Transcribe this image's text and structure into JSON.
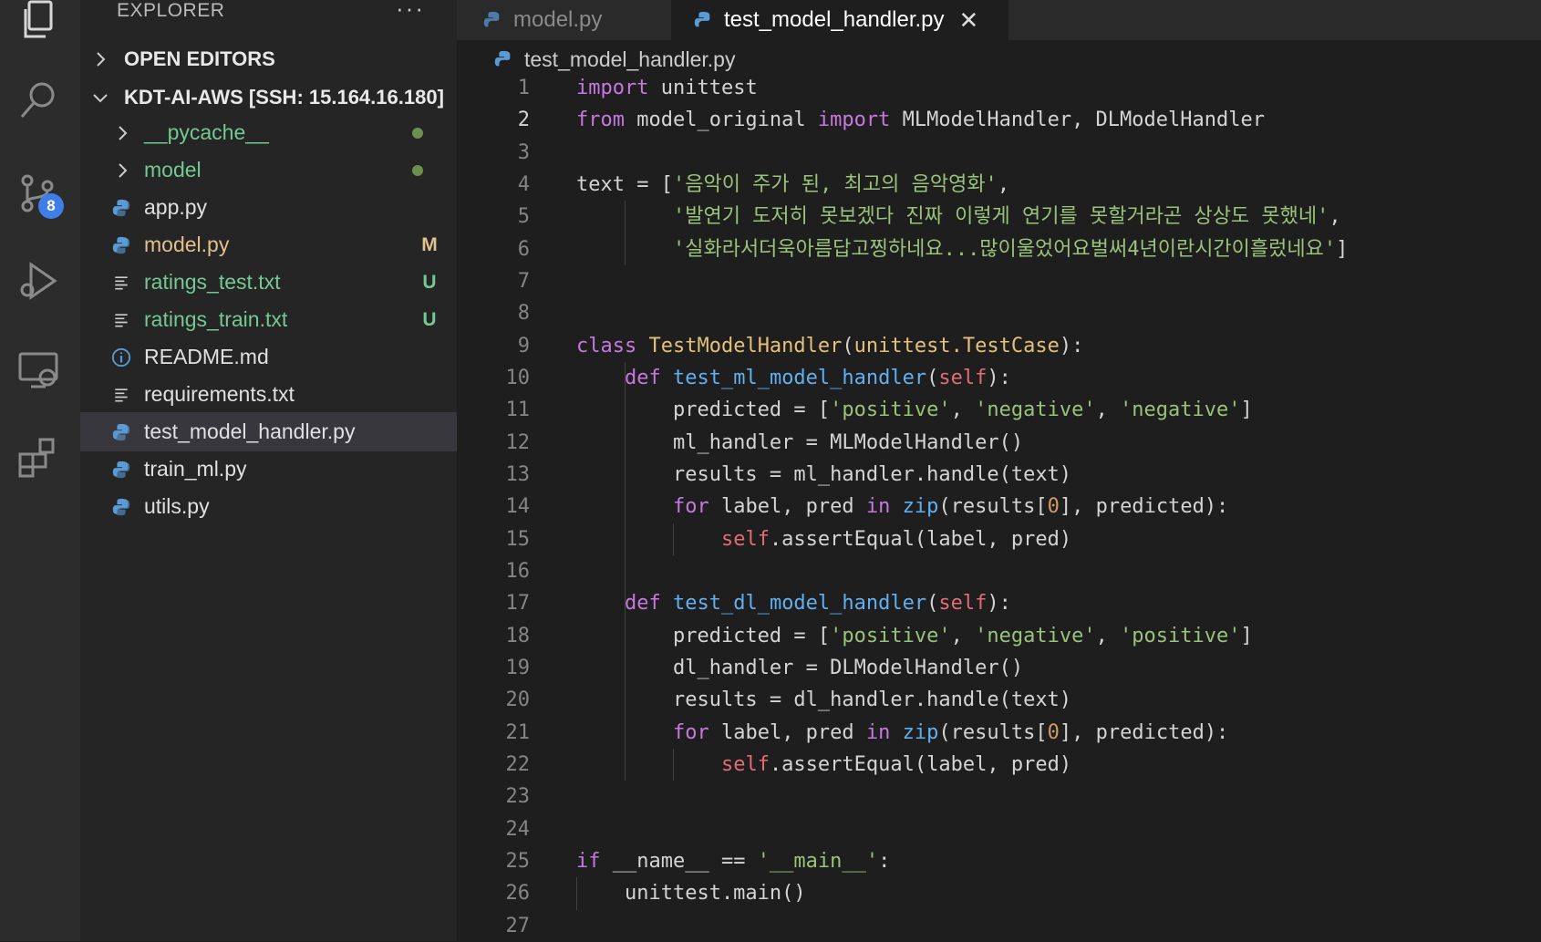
{
  "activity_bar": {
    "icons": [
      "files-icon",
      "search-icon",
      "source-control-icon",
      "run-debug-icon",
      "remote-explorer-icon",
      "extensions-icon"
    ],
    "source_control_badge": "8"
  },
  "sidebar": {
    "title": "EXPLORER",
    "more": "···",
    "open_editors": "OPEN EDITORS",
    "workspace": "KDT-AI-AWS [SSH: 15.164.16.180]",
    "items": [
      {
        "name": "__pycache__",
        "status": ""
      },
      {
        "name": "model",
        "status": ""
      },
      {
        "name": "app.py",
        "status": ""
      },
      {
        "name": "model.py",
        "status": "M"
      },
      {
        "name": "ratings_test.txt",
        "status": "U"
      },
      {
        "name": "ratings_train.txt",
        "status": "U"
      },
      {
        "name": "README.md",
        "status": ""
      },
      {
        "name": "requirements.txt",
        "status": ""
      },
      {
        "name": "test_model_handler.py",
        "status": ""
      },
      {
        "name": "train_ml.py",
        "status": ""
      },
      {
        "name": "utils.py",
        "status": ""
      }
    ]
  },
  "tabs": [
    {
      "label": "model.py"
    },
    {
      "label": "test_model_handler.py",
      "close": "✕"
    }
  ],
  "breadcrumb": "test_model_handler.py",
  "colors": {
    "keyword": "#c678dd",
    "class": "#e5c07b",
    "function": "#61afef",
    "string": "#98c379",
    "self": "#e06c75",
    "number": "#d19a66",
    "modified": "#e2c08d",
    "untracked": "#73c991"
  },
  "editor": {
    "current_line": "2",
    "line_numbers": [
      "1",
      "2",
      "3",
      "4",
      "5",
      "6",
      "7",
      "8",
      "9",
      "10",
      "11",
      "12",
      "13",
      "14",
      "15",
      "16",
      "17",
      "18",
      "19",
      "20",
      "21",
      "22",
      "23",
      "24",
      "25",
      "26",
      "27"
    ],
    "lines": [
      [
        [
          "kw",
          "import"
        ],
        [
          "t",
          " unittest"
        ]
      ],
      [
        [
          "kw",
          "from"
        ],
        [
          "t",
          " model_original "
        ],
        [
          "kw",
          "import"
        ],
        [
          "t",
          " MLModelHandler, DLModelHandler"
        ]
      ],
      [],
      [
        [
          "t",
          "text = ["
        ],
        [
          "str",
          "'음악이 주가 된, 최고의 음악영화'"
        ],
        [
          "t",
          ","
        ]
      ],
      [
        [
          "t",
          "        "
        ],
        [
          "str",
          "'발연기 도저히 못보겠다 진짜 이렇게 연기를 못할거라곤 상상도 못했네'"
        ],
        [
          "t",
          ","
        ]
      ],
      [
        [
          "t",
          "        "
        ],
        [
          "str",
          "'실화라서더욱아름답고찡하네요...많이울었어요벌써4년이란시간이흘렀네요'"
        ],
        [
          "t",
          "]"
        ]
      ],
      [],
      [],
      [
        [
          "kw",
          "class"
        ],
        [
          "t",
          " "
        ],
        [
          "cls",
          "TestModelHandler"
        ],
        [
          "t",
          "("
        ],
        [
          "cls",
          "unittest.TestCase"
        ],
        [
          "t",
          "):"
        ]
      ],
      [
        [
          "t",
          "    "
        ],
        [
          "kw",
          "def"
        ],
        [
          "t",
          " "
        ],
        [
          "fn",
          "test_ml_model_handler"
        ],
        [
          "t",
          "("
        ],
        [
          "self",
          "self"
        ],
        [
          "t",
          "):"
        ]
      ],
      [
        [
          "t",
          "        predicted = ["
        ],
        [
          "str",
          "'positive'"
        ],
        [
          "t",
          ", "
        ],
        [
          "str",
          "'negative'"
        ],
        [
          "t",
          ", "
        ],
        [
          "str",
          "'negative'"
        ],
        [
          "t",
          "]"
        ]
      ],
      [
        [
          "t",
          "        ml_handler = MLModelHandler()"
        ]
      ],
      [
        [
          "t",
          "        results = ml_handler.handle(text)"
        ]
      ],
      [
        [
          "t",
          "        "
        ],
        [
          "kw",
          "for"
        ],
        [
          "t",
          " label, pred "
        ],
        [
          "kw",
          "in"
        ],
        [
          "t",
          " "
        ],
        [
          "fn",
          "zip"
        ],
        [
          "t",
          "(results["
        ],
        [
          "num",
          "0"
        ],
        [
          "t",
          "], predicted):"
        ]
      ],
      [
        [
          "t",
          "            "
        ],
        [
          "self",
          "self"
        ],
        [
          "t",
          ".assertEqual(label, pred)"
        ]
      ],
      [],
      [
        [
          "t",
          "    "
        ],
        [
          "kw",
          "def"
        ],
        [
          "t",
          " "
        ],
        [
          "fn",
          "test_dl_model_handler"
        ],
        [
          "t",
          "("
        ],
        [
          "self",
          "self"
        ],
        [
          "t",
          "):"
        ]
      ],
      [
        [
          "t",
          "        predicted = ["
        ],
        [
          "str",
          "'positive'"
        ],
        [
          "t",
          ", "
        ],
        [
          "str",
          "'negative'"
        ],
        [
          "t",
          ", "
        ],
        [
          "str",
          "'positive'"
        ],
        [
          "t",
          "]"
        ]
      ],
      [
        [
          "t",
          "        dl_handler = DLModelHandler()"
        ]
      ],
      [
        [
          "t",
          "        results = dl_handler.handle(text)"
        ]
      ],
      [
        [
          "t",
          "        "
        ],
        [
          "kw",
          "for"
        ],
        [
          "t",
          " label, pred "
        ],
        [
          "kw",
          "in"
        ],
        [
          "t",
          " "
        ],
        [
          "fn",
          "zip"
        ],
        [
          "t",
          "(results["
        ],
        [
          "num",
          "0"
        ],
        [
          "t",
          "], predicted):"
        ]
      ],
      [
        [
          "t",
          "            "
        ],
        [
          "self",
          "self"
        ],
        [
          "t",
          ".assertEqual(label, pred)"
        ]
      ],
      [],
      [],
      [
        [
          "kw",
          "if"
        ],
        [
          "t",
          " __name__ == "
        ],
        [
          "str",
          "'__main__'"
        ],
        [
          "t",
          ":"
        ]
      ],
      [
        [
          "t",
          "    unittest.main()"
        ]
      ],
      []
    ]
  }
}
